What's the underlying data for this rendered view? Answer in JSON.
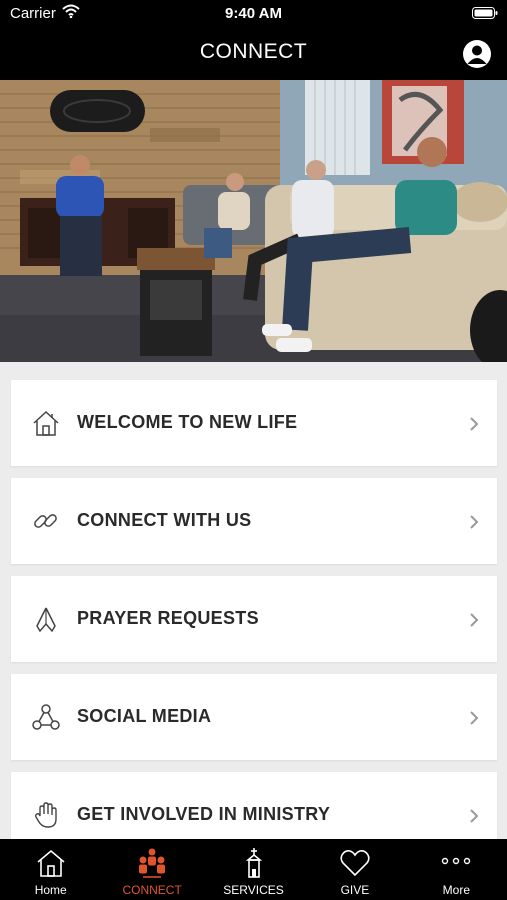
{
  "status": {
    "carrier": "Carrier",
    "time": "9:40 AM"
  },
  "header": {
    "title": "CONNECT"
  },
  "menu": {
    "items": [
      {
        "label": "WELCOME TO NEW LIFE",
        "icon": "home-icon"
      },
      {
        "label": "CONNECT WITH US",
        "icon": "link-icon"
      },
      {
        "label": "PRAYER REQUESTS",
        "icon": "praying-hands-icon"
      },
      {
        "label": "SOCIAL MEDIA",
        "icon": "share-icon"
      },
      {
        "label": "GET INVOLVED IN MINISTRY",
        "icon": "hand-icon"
      }
    ]
  },
  "tabs": [
    {
      "label": "Home",
      "icon": "home-icon",
      "active": false
    },
    {
      "label": "CONNECT",
      "icon": "people-icon",
      "active": true
    },
    {
      "label": "SERVICES",
      "icon": "church-icon",
      "active": false
    },
    {
      "label": "GIVE",
      "icon": "heart-icon",
      "active": false
    },
    {
      "label": "More",
      "icon": "more-icon",
      "active": false
    }
  ],
  "colors": {
    "accent": "#e0552e",
    "bar_background": "#000000",
    "page_background": "#ececec"
  }
}
